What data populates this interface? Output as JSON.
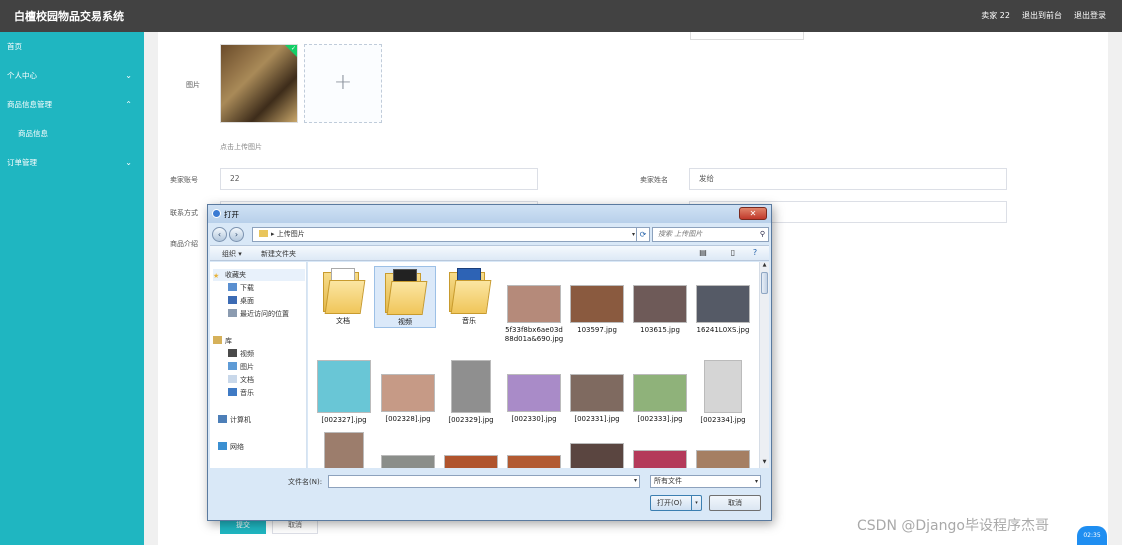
{
  "app": {
    "title": "白檀校园物品交易系统",
    "user_label": "卖家 22",
    "front_link": "退出到前台",
    "logout": "退出登录"
  },
  "sidebar": {
    "items": [
      {
        "label": "首页",
        "chevron": ""
      },
      {
        "label": "个人中心",
        "chevron": "⌄"
      },
      {
        "label": "商品信息管理",
        "chevron": "⌃"
      },
      {
        "label": "商品信息",
        "chevron": ""
      },
      {
        "label": "订单管理",
        "chevron": "⌄"
      }
    ]
  },
  "form": {
    "image_label": "图片",
    "upload_hint": "点击上传图片",
    "plus": "+",
    "check": "✓",
    "seller_account_label": "卖家账号",
    "seller_account_value": "22",
    "seller_name_label": "卖家姓名",
    "seller_name_value": "发给",
    "contact_label": "联系方式",
    "intro_label": "商品介绍",
    "submit": "提交",
    "cancel": "取消"
  },
  "dialog": {
    "title": "打开",
    "close": "✕",
    "path": "上传图片",
    "search_placeholder": "搜索 上传图片",
    "organize": "组织 ▾",
    "new_folder": "新建文件夹",
    "nav": {
      "favorites": "收藏夹",
      "downloads": "下载",
      "desktop": "桌面",
      "recent": "最近访问的位置",
      "libraries": "库",
      "videos": "视频",
      "pictures": "图片",
      "documents": "文档",
      "music": "音乐",
      "computer": "计算机",
      "network": "网络"
    },
    "files_row1": [
      {
        "name": "文档",
        "kind": "folder"
      },
      {
        "name": "视频",
        "kind": "folder"
      },
      {
        "name": "音乐",
        "kind": "folder"
      },
      {
        "name": "5f33f8bx6ae03d88d01a&690.jpg",
        "kind": "image",
        "color": "#b58a7a"
      },
      {
        "name": "103597.jpg",
        "kind": "image",
        "color": "#8a5a3f"
      },
      {
        "name": "103615.jpg",
        "kind": "image",
        "color": "#6e5a58"
      },
      {
        "name": "16241L0XS.jpg",
        "kind": "image",
        "color": "#555a66"
      }
    ],
    "files_row2": [
      {
        "name": "[002327].jpg",
        "kind": "image",
        "color": "#69c6d6"
      },
      {
        "name": "[002328].jpg",
        "kind": "image",
        "color": "#c69a86"
      },
      {
        "name": "[002329].jpg",
        "kind": "image",
        "color": "#8f8f8f"
      },
      {
        "name": "[002330].jpg",
        "kind": "image",
        "color": "#a98bc8"
      },
      {
        "name": "[002331].jpg",
        "kind": "image",
        "color": "#7f6a60"
      },
      {
        "name": "[002333].jpg",
        "kind": "image",
        "color": "#8fb27a"
      },
      {
        "name": "[002334].jpg",
        "kind": "image",
        "color": "#d5d5d5"
      }
    ],
    "files_row3": [
      {
        "color": "#9c7d6c"
      },
      {
        "color": "#8b8e8a"
      },
      {
        "color": "#b0542d"
      },
      {
        "color": "#b25a32"
      },
      {
        "color": "#5a4540"
      },
      {
        "color": "#b43a5a"
      },
      {
        "color": "#a57f63"
      }
    ],
    "filename_label": "文件名(N):",
    "filter": "所有文件",
    "open_btn": "打开(O)",
    "cancel_btn": "取消"
  },
  "watermark": "CSDN @Django毕设程序杰哥",
  "clock": "02:35"
}
